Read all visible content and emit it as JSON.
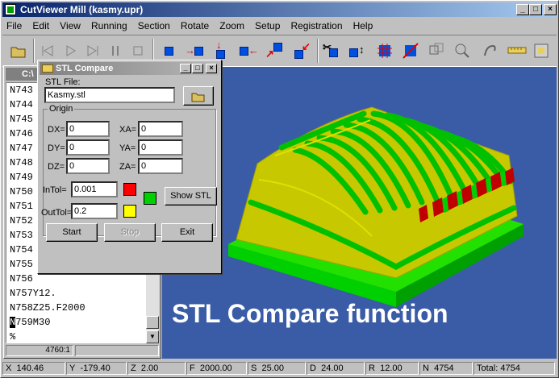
{
  "window": {
    "title": "CutViewer Mill (kasmy.upr)"
  },
  "menu": [
    "File",
    "Edit",
    "View",
    "Running",
    "Section",
    "Rotate",
    "Zoom",
    "Setup",
    "Registration",
    "Help"
  ],
  "code_window": {
    "title": "C:\\",
    "lines": [
      "N743",
      "N744",
      "N745",
      "N746",
      "N747",
      "N748",
      "N749",
      "N750",
      "N751",
      "N752",
      "N753",
      "N754",
      "N755",
      "N756",
      "N757Y12.",
      "N758Z25.F2000",
      "N759M30",
      "%"
    ],
    "status_left": "4760:1"
  },
  "dialog": {
    "title": "STL Compare",
    "stl_file_label": "STL File:",
    "stl_file_value": "Kasmy.stl",
    "origin_label": "Origin",
    "dx_label": "DX=",
    "dx_value": "0",
    "dy_label": "DY=",
    "dy_value": "0",
    "dz_label": "DZ=",
    "dz_value": "0",
    "xa_label": "XA=",
    "xa_value": "0",
    "ya_label": "YA=",
    "ya_value": "0",
    "za_label": "ZA=",
    "za_value": "0",
    "intol_label": "InTol=",
    "intol_value": "0.001",
    "outtol_label": "OutTol=",
    "outtol_value": "0.2",
    "show_stl_label": "Show STL",
    "start_label": "Start",
    "stop_label": "Stop",
    "exit_label": "Exit",
    "colors": {
      "intol": "#ff0000",
      "match": "#00d000",
      "outtol": "#ffff00"
    }
  },
  "viewport": {
    "caption": "STL Compare function"
  },
  "statusbar": {
    "x_label": "X",
    "x_value": "140.46",
    "y_label": "Y",
    "y_value": "-179.40",
    "z_label": "Z",
    "z_value": "2.00",
    "f_label": "F",
    "f_value": "2000.00",
    "s_label": "S",
    "s_value": "25.00",
    "d_label": "D",
    "d_value": "24.00",
    "r_label": "R",
    "r_value": "12.00",
    "n_label": "N",
    "n_value": "4754",
    "total_label": "Total:",
    "total_value": "4754"
  }
}
